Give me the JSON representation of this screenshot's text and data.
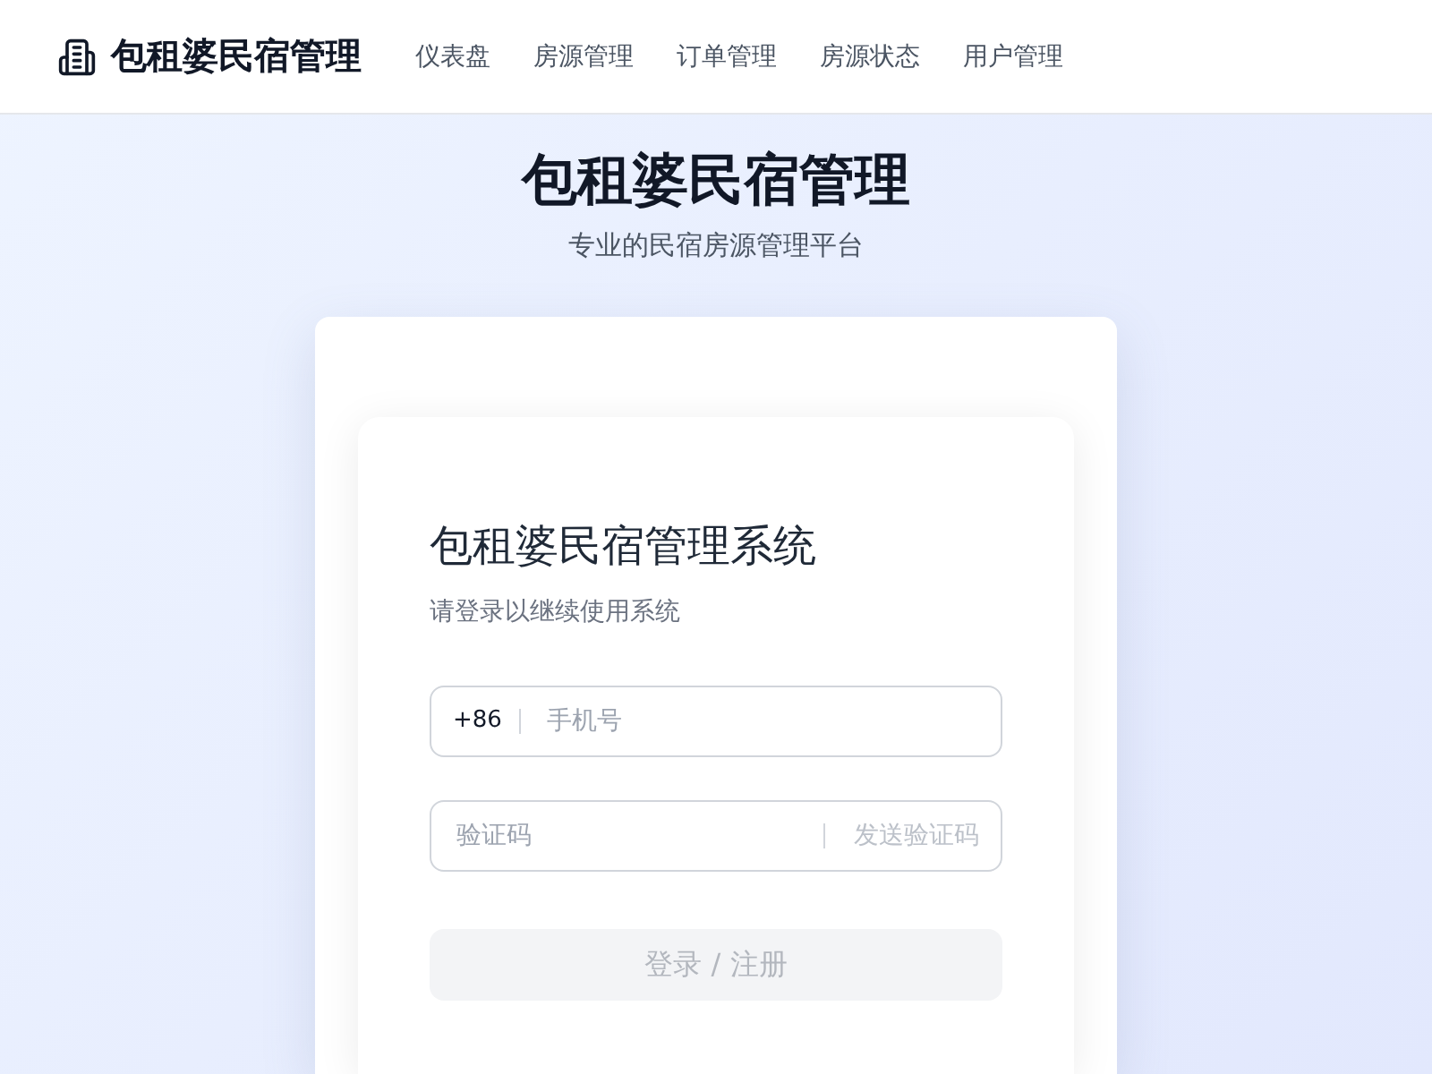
{
  "header": {
    "brand": "包租婆民宿管理",
    "nav": [
      {
        "label": "仪表盘",
        "selected": false
      },
      {
        "label": "房源管理",
        "selected": false
      },
      {
        "label": "订单管理",
        "selected": false
      },
      {
        "label": "房源状态",
        "selected": false
      },
      {
        "label": "用户管理",
        "selected": false
      }
    ]
  },
  "hero": {
    "title": "包租婆民宿管理",
    "subtitle": "专业的民宿房源管理平台"
  },
  "login": {
    "title": "包租婆民宿管理系统",
    "subtitle": "请登录以继续使用系统",
    "country_code": "+86",
    "phone": {
      "placeholder": "手机号"
    },
    "code": {
      "placeholder": "验证码"
    },
    "send_code": {
      "label": "发送验证码",
      "disabled": true
    },
    "submit": {
      "label": "登录 / 注册",
      "disabled": true
    }
  }
}
